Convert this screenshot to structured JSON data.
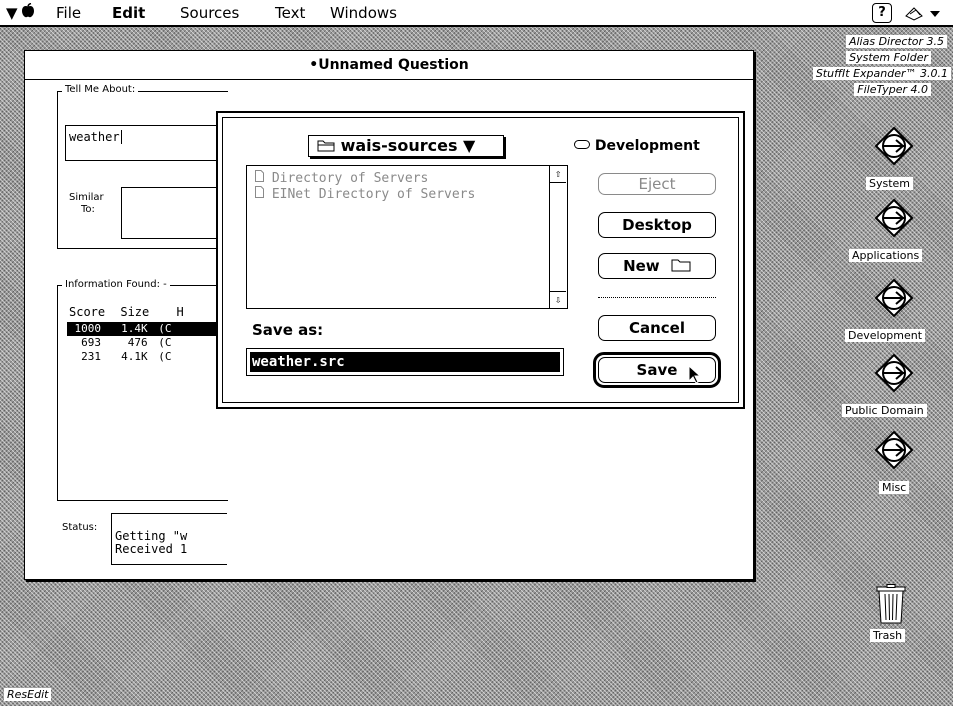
{
  "menubar": {
    "items": [
      "File",
      "Edit",
      "Sources",
      "Text",
      "Windows"
    ],
    "help_glyph": "?",
    "apple_icon": "apple-icon",
    "app_icon": "app-switch-icon"
  },
  "desktop": {
    "top_labels": [
      "Alias Director 3.5",
      "System Folder",
      "StuffIt Expander™ 3.0.1",
      "FileTyper 4.0"
    ],
    "icons": [
      {
        "label": "System",
        "icon": "volume-icon"
      },
      {
        "label": "Applications",
        "icon": "volume-icon"
      },
      {
        "label": "Development",
        "icon": "volume-icon"
      },
      {
        "label": "Public Domain",
        "icon": "volume-icon"
      },
      {
        "label": "Misc",
        "icon": "volume-icon"
      }
    ],
    "trash_label": "Trash",
    "resedit_label": "ResEdit"
  },
  "main_window": {
    "title": "•Unnamed Question",
    "tell_me_about_label": "Tell Me About:",
    "query_value": "weather",
    "similar_label": "Similar",
    "similar_label2": "To:",
    "info_found_label": "Information Found: -",
    "columns": [
      "Score",
      "Size",
      "H"
    ],
    "rows": [
      {
        "score": "1000",
        "size": "1.4K",
        "rest": "(C"
      },
      {
        "score": "693",
        "size": "476",
        "rest": "(C"
      },
      {
        "score": "231",
        "size": "4.1K",
        "rest": "(C"
      }
    ],
    "status_label": "Status:",
    "status_lines": [
      "Getting \"w",
      "Received 1"
    ]
  },
  "save_dialog": {
    "folder_popup": "wais-sources",
    "volume_name": "Development",
    "files": [
      "Directory of Servers",
      "EINet Directory of Servers"
    ],
    "eject_label": "Eject",
    "desktop_label": "Desktop",
    "new_label": "New",
    "save_as_label": "Save as:",
    "save_as_value": "weather.src",
    "cancel_label": "Cancel",
    "save_label": "Save"
  }
}
